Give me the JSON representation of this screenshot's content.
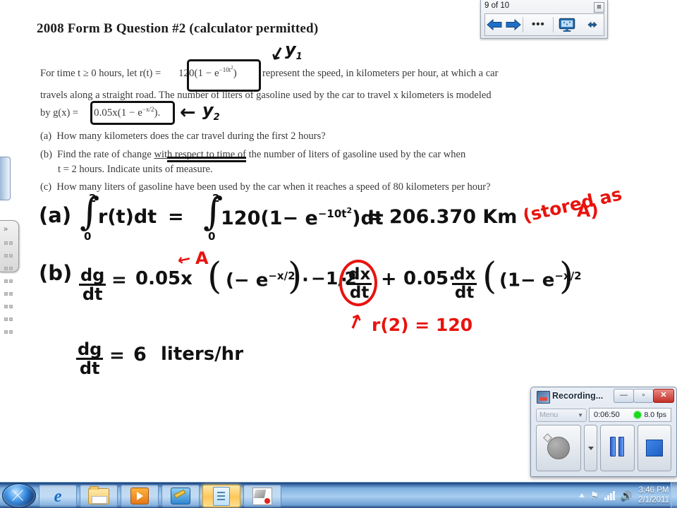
{
  "document": {
    "title": "2008 Form B Question #2 (calculator permitted)",
    "intro": {
      "line1_a": "For time  t ≥ 0  hours, let  r(t) =",
      "line1_eq": "120(1 − e",
      "line1_exp": "−10t",
      "line1_exp2": "2",
      "line1_eq_end": ")",
      "line1_b": "represent the speed, in kilometers per hour, at which a car",
      "line2": "travels along a straight road. The number of liters of gasoline used by the car to travel  x  kilometers is modeled",
      "line3_a": "by  g(x) =",
      "line3_eq": "0.05x(1 − e",
      "line3_exp": "−x/2",
      "line3_eq_end": ").",
      "annot_y1": "y",
      "annot_y1_sub": "1",
      "annot_y2": "y",
      "annot_y2_sub": "2"
    },
    "parts": [
      {
        "label": "(a)",
        "text": "How many kilometers does the car travel during the first 2 hours?"
      },
      {
        "label": "(b)",
        "text_a": "Find the rate of change ",
        "text_underlined": "with respect to time",
        "text_b": " of the number of liters of gasoline used by the car when",
        "text_line2": "t = 2  hours. Indicate units of measure."
      },
      {
        "label": "(c)",
        "text": "How many liters of gasoline have been used by the car when it reaches a speed of 80 kilometers per hour?"
      }
    ]
  },
  "handwriting": {
    "a": {
      "label": "(a)",
      "int1_upper": "2",
      "int1_lower": "0",
      "int1_body": "r(t)dt",
      "equals1": "=",
      "int2_upper": "2",
      "int2_lower": "0",
      "int2_body_a": "120(1− e",
      "int2_exp": "−10t",
      "int2_exp2": "2",
      "int2_body_b": ")dt",
      "equals2": "=",
      "result": "206.370  Km",
      "red_note": "(stored as",
      "red_note_A": "A)"
    },
    "b": {
      "label": "(b)",
      "frac_num": "dg",
      "frac_den": "dt",
      "equals": "=",
      "term1": "0.05x",
      "red_A": "A",
      "paren_a": "(− e",
      "exp_a": "−x/2",
      "paren_a_end": ")",
      "dot1": "·",
      "half": "−1/2",
      "dot2": "·",
      "dxdt_num": "dx",
      "dxdt_den": "dt",
      "plus": "+",
      "term2": "0.05·",
      "dxdt2_num": "dx",
      "dxdt2_den": "dt",
      "paren_b": "(1− e",
      "exp_b": "−x/2",
      "paren_b_end": ")",
      "red_r2": "r(2) = 120",
      "ans_num": "dg",
      "ans_den": "dt",
      "ans_equals": "=",
      "ans_value": "6",
      "ans_units": "liters/hr"
    }
  },
  "navbar": {
    "page_indicator": "9 of 10",
    "close_glyph": "⊠",
    "back_label": "back-arrow",
    "forward_label": "forward-arrow",
    "more_label": "•••",
    "monitor_label": "monitor",
    "resize_label": "↔"
  },
  "recorder": {
    "title": "Recording...",
    "minimize": "—",
    "maximize": "▫",
    "close": "✕",
    "menu_label": "Menu",
    "menu_caret": "▼",
    "elapsed": "0:06:50",
    "fps": "8.0 fps",
    "led_color": "#19dd1b",
    "record_button": "record",
    "dropdown_button": "record-options",
    "pause_button": "pause",
    "stop_button": "stop"
  },
  "taskbar": {
    "start_label": "Start",
    "buttons": [
      {
        "name": "internet-explorer",
        "active": false
      },
      {
        "name": "windows-explorer",
        "active": false
      },
      {
        "name": "media-player",
        "active": false
      },
      {
        "name": "paint",
        "active": false
      },
      {
        "name": "journal-note",
        "active": true
      },
      {
        "name": "snipping-tool",
        "active": false
      }
    ],
    "tray": {
      "overflow": "▲",
      "action_center": "⚑",
      "network": "signal",
      "volume": "🔊",
      "time": "3:46 PM",
      "date": "2/1/2011"
    }
  },
  "sidebar": {
    "chevrons": "»",
    "pad_label": "toolbar-flyout"
  }
}
